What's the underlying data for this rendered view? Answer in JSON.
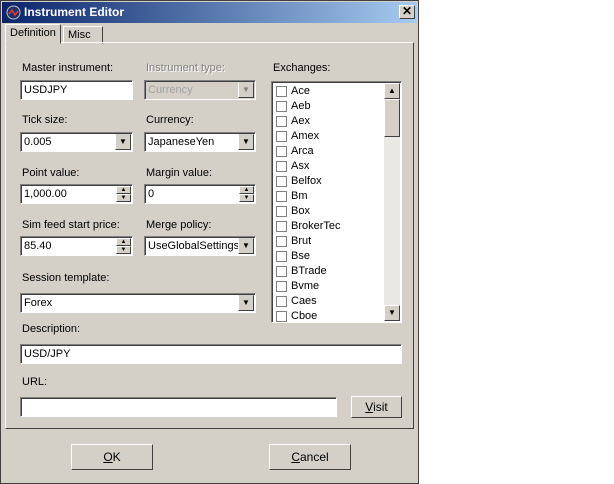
{
  "window": {
    "title": "Instrument Editor",
    "close_glyph": "✕"
  },
  "tabs": [
    {
      "label": "Definition"
    },
    {
      "label": "Misc"
    }
  ],
  "fields": {
    "master_instrument": {
      "label": "Master instrument:",
      "value": "USDJPY"
    },
    "instrument_type": {
      "label": "Instrument type:",
      "value": "Currency"
    },
    "tick_size": {
      "label": "Tick size:",
      "value": "0.005"
    },
    "currency": {
      "label": "Currency:",
      "value": "JapaneseYen"
    },
    "point_value": {
      "label": "Point value:",
      "value": "1,000.00"
    },
    "margin_value": {
      "label": "Margin value:",
      "value": "0"
    },
    "sim_feed_start_price": {
      "label": "Sim feed start price:",
      "value": "85.40"
    },
    "merge_policy": {
      "label": "Merge policy:",
      "value": "UseGlobalSettings"
    },
    "session_template": {
      "label": "Session template:",
      "value": "Forex"
    },
    "description": {
      "label": "Description:",
      "value": "USD/JPY"
    },
    "url": {
      "label": "URL:",
      "value": ""
    }
  },
  "exchanges": {
    "label": "Exchanges:",
    "items": [
      "Ace",
      "Aeb",
      "Aex",
      "Amex",
      "Arca",
      "Asx",
      "Belfox",
      "Bm",
      "Box",
      "BrokerTec",
      "Brut",
      "Bse",
      "BTrade",
      "Bvme",
      "Caes",
      "Cboe"
    ]
  },
  "buttons": {
    "visit_prefix": "V",
    "visit_rest": "isit",
    "ok_prefix": "O",
    "ok_rest": "K",
    "cancel_prefix": "C",
    "cancel_rest": "ancel"
  },
  "icons": {
    "dropdown": "▼",
    "spin_up": "▲",
    "spin_down": "▼",
    "scroll_up": "▲",
    "scroll_down": "▼"
  },
  "colors": {
    "titlebar_start": "#0a246a",
    "titlebar_end": "#a6caf0",
    "face": "#d4d0c8"
  }
}
